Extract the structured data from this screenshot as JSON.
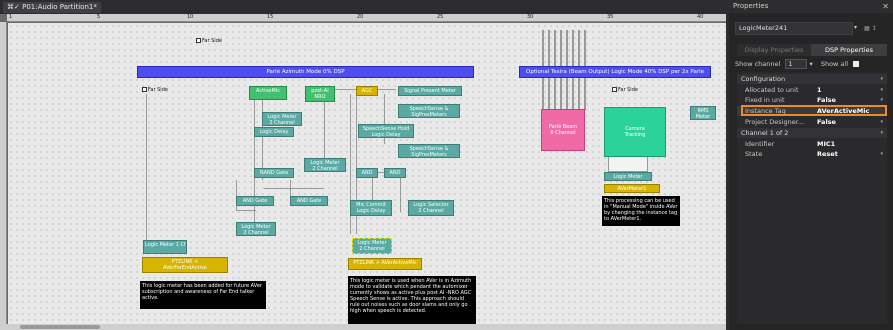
{
  "document_tab": {
    "icon": "⌘✓",
    "label": "P01:Audio Partition1*"
  },
  "ruler": {
    "top": [
      "1",
      "5",
      "10",
      "15",
      "20",
      "25",
      "30",
      "35",
      "40"
    ]
  },
  "canvas": {
    "banners": [
      "Parlé Azimuth Mode 0% DSP",
      "Optional Tesira (Beam Output) Logic Mode 40% DSP per 2x Parle"
    ],
    "inputs": {
      "far_side_top": "Far Side",
      "far_side_left": "Far Side",
      "active_mic": "ActiveMic",
      "far_side_right": "Far Side"
    },
    "blocks": {
      "post_ai_nro": "post-AI\nNRO",
      "agc": "AGC",
      "signal_present": "Signal Present Meter",
      "speechsense_1": "SpeechSense &\nSigPresMeters",
      "speechsense_hold": "SpeechSense Hold\nLogic Delay",
      "speechsense_2": "SpeechSense &\nSigPresMeters",
      "logic_meter_2ch_a": "Logic Meter\n2 Channel",
      "logic_delay": "Logic Delay",
      "logic_meter_2ch_b": "Logic Meter\n2 Channel",
      "nand_gate": "NAND Gate",
      "and_1": "AND",
      "and_2": "AND",
      "and_gate": "AND Gate",
      "and_gate_2": "AND Gate",
      "mic_commit": "Mic Commit\nLogic Delay",
      "logic_selector": "Logic Selector\n2 Channel",
      "logic_meter_2ch_c": "Logic Meter\n2 Channel",
      "logic_meter_1ch": "Logic Meter\n1 Channel",
      "logic_meter_2ch_d": "Logic Meter\n2 Channel",
      "parle_beam": "Parlé Beam\n8 Channel",
      "camera_tracking": "Camera\nTracking",
      "rms_meter": "RMS\nMeter",
      "logic_meter_right": "Logic Meter",
      "aver_meter1": "AVerMeter1"
    },
    "ptz_links": [
      "PTZLINK >\nAVerFarEndActive",
      "PTZLINK > AVerActiveMic"
    ],
    "notes": [
      "This logic meter has been added for future AVer subscription and awareness of Far End talker active.",
      "This logic meter is used when AVer is in Azimuth mode to validate which pendant the automixer currently shows as active plus post AI -NRO AGC Speech Sense is active. This approach should rule out noises such as door slams and only go high when speech is detected.",
      "This processing can be used in \"Manual Mode\" inside AVer by changing the instance tag to AVerMeter1."
    ]
  },
  "properties": {
    "title": "Properties",
    "close_glyph": "✕",
    "selected_object": "LogicMeter241",
    "tabs": [
      {
        "label": "Display Properties",
        "active": false
      },
      {
        "label": "DSP Properties",
        "active": true
      }
    ],
    "show_channel_label": "Show channel",
    "channel_value": "1",
    "show_all_label": "Show all",
    "rows": [
      {
        "type": "cat",
        "key": "Configuration"
      },
      {
        "type": "row",
        "key": "Allocated to unit",
        "value": "1",
        "dropdown": true
      },
      {
        "type": "row",
        "key": "Fixed in unit",
        "value": "False",
        "dropdown": true
      },
      {
        "type": "row",
        "key": "Instance Tag",
        "value": "AVerActiveMic",
        "dropdown": false
      },
      {
        "type": "row",
        "key": "Project Designer...",
        "value": "False",
        "dropdown": true
      },
      {
        "type": "cat",
        "key": "Channel  1 of 2"
      },
      {
        "type": "row",
        "key": "Identifier",
        "value": "MIC1",
        "dropdown": false
      },
      {
        "type": "row",
        "key": "State",
        "value": "Reset",
        "dropdown": true
      }
    ],
    "highlight_color": "#f08a24"
  }
}
